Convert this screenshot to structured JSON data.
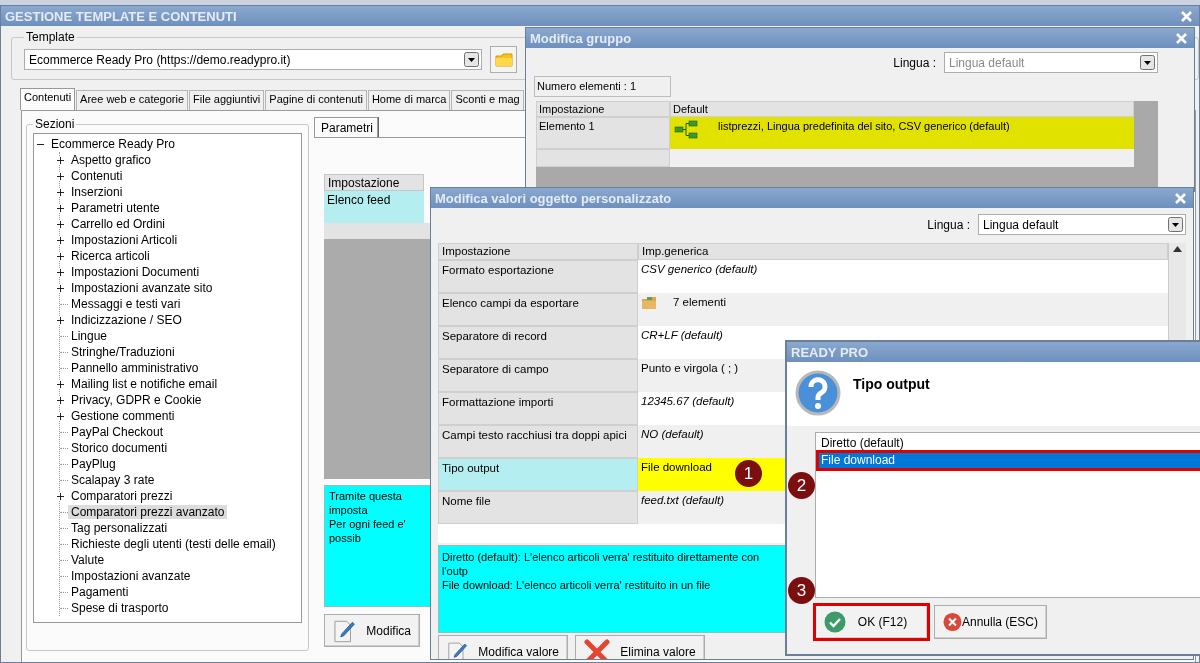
{
  "main_window": {
    "title": "GESTIONE TEMPLATE E CONTENUTI",
    "template": {
      "label": "Template",
      "value": "Ecommerce Ready Pro (https://demo.readypro.it)"
    },
    "tabs": [
      {
        "label": "Contenuti",
        "selected": true
      },
      {
        "label": "Aree web e categorie",
        "selected": false
      },
      {
        "label": "File aggiuntivi",
        "selected": false
      },
      {
        "label": "Pagine di contenuti",
        "selected": false
      },
      {
        "label": "Home di marca",
        "selected": false
      },
      {
        "label": "Sconti e mag",
        "selected": false
      }
    ],
    "sections": {
      "label": "Sezioni",
      "tree": {
        "label": "Ecommerce Ready Pro",
        "expanded": true,
        "selected": false,
        "children": [
          {
            "label": "Aspetto grafico",
            "kind": "group",
            "expanded": false,
            "selected": false
          },
          {
            "label": "Contenuti",
            "kind": "group",
            "expanded": false,
            "selected": false
          },
          {
            "label": "Inserzioni",
            "kind": "group",
            "expanded": false,
            "selected": false
          },
          {
            "label": "Parametri utente",
            "kind": "group",
            "expanded": false,
            "selected": false
          },
          {
            "label": "Carrello ed Ordini",
            "kind": "group",
            "expanded": false,
            "selected": false
          },
          {
            "label": "Impostazioni Articoli",
            "kind": "group",
            "expanded": false,
            "selected": false
          },
          {
            "label": "Ricerca articoli",
            "kind": "group",
            "expanded": false,
            "selected": false
          },
          {
            "label": "Impostazioni Documenti",
            "kind": "group",
            "expanded": false,
            "selected": false
          },
          {
            "label": "Impostazioni avanzate sito",
            "kind": "group",
            "expanded": false,
            "selected": false
          },
          {
            "label": "Messaggi e testi vari",
            "kind": "leaf",
            "selected": false
          },
          {
            "label": "Indicizzazione / SEO",
            "kind": "group",
            "expanded": false,
            "selected": false
          },
          {
            "label": "Lingue",
            "kind": "leaf",
            "selected": false
          },
          {
            "label": "Stringhe/Traduzioni",
            "kind": "leaf",
            "selected": false
          },
          {
            "label": "Pannello amministrativo",
            "kind": "leaf",
            "selected": false
          },
          {
            "label": "Mailing list e notifiche email",
            "kind": "group",
            "expanded": false,
            "selected": false
          },
          {
            "label": "Privacy, GDPR e Cookie",
            "kind": "group",
            "expanded": false,
            "selected": false
          },
          {
            "label": "Gestione commenti",
            "kind": "group",
            "expanded": false,
            "selected": false
          },
          {
            "label": "PayPal Checkout",
            "kind": "leaf",
            "selected": false
          },
          {
            "label": "Storico documenti",
            "kind": "leaf",
            "selected": false
          },
          {
            "label": "PayPlug",
            "kind": "leaf",
            "selected": false
          },
          {
            "label": "Scalapay 3 rate",
            "kind": "leaf",
            "selected": false
          },
          {
            "label": "Comparatori prezzi",
            "kind": "group",
            "expanded": false,
            "selected": false
          },
          {
            "label": "Comparatori prezzi avanzato",
            "kind": "leaf",
            "selected": true
          },
          {
            "label": "Tag personalizzati",
            "kind": "leaf",
            "selected": false
          },
          {
            "label": "Richieste degli utenti (testi delle email)",
            "kind": "leaf",
            "selected": false
          },
          {
            "label": "Valute",
            "kind": "leaf",
            "selected": false
          },
          {
            "label": "Impostazioni avanzate",
            "kind": "leaf",
            "selected": false
          },
          {
            "label": "Pagamenti",
            "kind": "leaf",
            "selected": false
          },
          {
            "label": "Spese di trasporto",
            "kind": "leaf",
            "selected": false
          }
        ]
      }
    },
    "parameters": {
      "tab": "Parametri",
      "columns": [
        "Impostazione"
      ],
      "rows": [
        {
          "setting": "Elenco feed",
          "selected": true
        }
      ],
      "info": [
        "Tramite questa imposta",
        "Per ogni feed e' possib"
      ],
      "buttons": [
        {
          "label": "Modifica",
          "kind": "edit"
        }
      ]
    }
  },
  "group_dialog": {
    "title": "Modifica gruppo",
    "language_label": "Lingua :",
    "language": {
      "value": "Lingua default",
      "disabled": true
    },
    "count": "Numero elementi : 1",
    "columns": [
      "Impostazione",
      "Default"
    ],
    "rows": [
      {
        "setting": "Elemento 1",
        "value": "listprezzi, Lingua predefinita del sito, CSV generico (default)",
        "selected": true
      }
    ]
  },
  "values_dialog": {
    "title": "Modifica valori oggetto personalizzato",
    "language_label": "Lingua :",
    "language": {
      "value": "Lingua default",
      "disabled": false
    },
    "columns": [
      "Impostazione",
      "Imp.generica"
    ],
    "rows": [
      {
        "setting": "Formato esportazione",
        "value": "CSV generico (default)",
        "kind": "text",
        "is_default": true,
        "selected": false
      },
      {
        "setting": "Elenco campi da esportare",
        "value": "7 elementi",
        "kind": "list",
        "is_default": false,
        "selected": false
      },
      {
        "setting": "Separatore di record",
        "value": "CR+LF (default)",
        "kind": "text",
        "is_default": true,
        "selected": false
      },
      {
        "setting": "Separatore di campo",
        "value": "Punto e virgola ( ; )",
        "kind": "text",
        "is_default": false,
        "selected": false
      },
      {
        "setting": "Formattazione importi",
        "value": "12345.67 (default)",
        "kind": "text",
        "is_default": true,
        "selected": false
      },
      {
        "setting": "Campi testo racchiusi tra doppi apici",
        "value": "NO (default)",
        "kind": "text",
        "is_default": true,
        "selected": false
      },
      {
        "setting": "Tipo output",
        "value": "File download",
        "kind": "text",
        "is_default": false,
        "selected": true
      },
      {
        "setting": "Nome file",
        "value": "feed.txt (default)",
        "kind": "text",
        "is_default": true,
        "selected": false
      }
    ],
    "info": [
      "Diretto (default): L'elenco articoli verra' restituito direttamente con l'outp",
      "File download: L'elenco articoli verra' restituito in un file"
    ],
    "buttons": [
      {
        "label": "Modifica valore",
        "kind": "edit"
      },
      {
        "label": "Elimina valore",
        "kind": "delete"
      }
    ]
  },
  "choice_dialog": {
    "title": "READY PRO",
    "heading": "Tipo output",
    "options": [
      {
        "label": "Diretto (default)",
        "selected": false,
        "highlighted": false
      },
      {
        "label": "File download",
        "selected": true,
        "highlighted": true
      }
    ],
    "buttons": [
      {
        "label": "OK (F12)",
        "kind": "ok",
        "highlighted": true
      },
      {
        "label": "Annulla (ESC)",
        "kind": "cancel",
        "highlighted": false
      }
    ]
  },
  "step_badges": [
    "1",
    "2",
    "3"
  ]
}
